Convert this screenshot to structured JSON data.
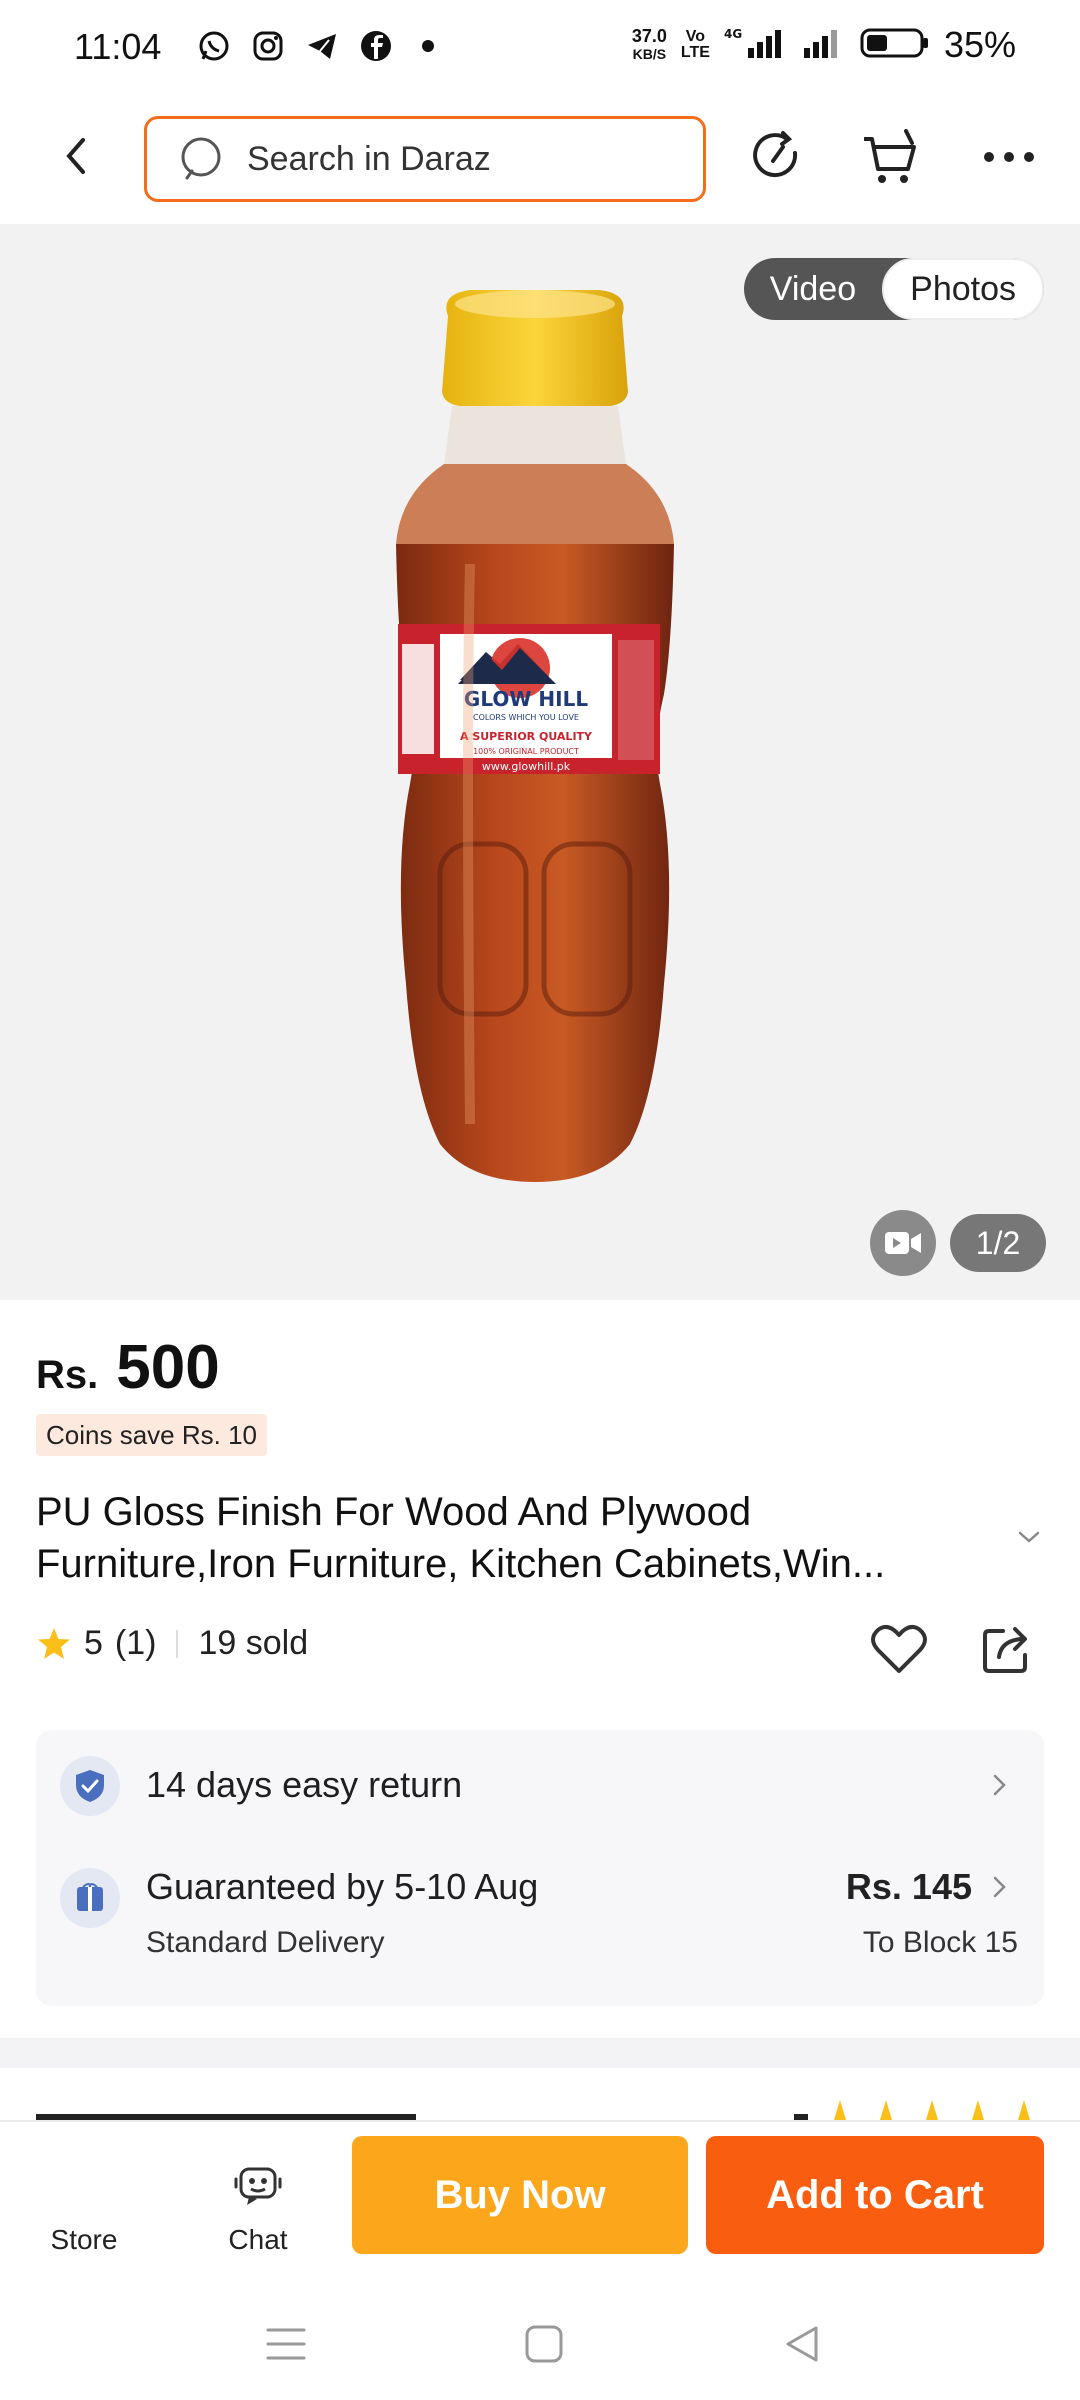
{
  "status_bar": {
    "time": "11:04",
    "app_icons": [
      "whatsapp-icon",
      "instagram-icon",
      "telegram-icon",
      "facebook-icon"
    ],
    "speed_value": "37.0",
    "speed_unit": "KB/S",
    "volte_top": "Vo",
    "volte_bottom": "LTE",
    "network": "4G",
    "battery": "35%"
  },
  "header": {
    "search_placeholder": "Search in Daraz",
    "accent_color": "#f36d1c"
  },
  "gallery": {
    "tabs": [
      "Video",
      "Photos"
    ],
    "active_tab": "Photos",
    "counter": "1/2",
    "label_brand": "GLOW HILL",
    "label_tagline": "COLORS WHICH YOU LOVE",
    "label_quality": "A SUPERIOR QUALITY",
    "label_original": "100% ORIGINAL PRODUCT",
    "label_site": "www.glowhill.pk"
  },
  "product": {
    "currency": "Rs.",
    "price": "500",
    "coins_text": "Coins save Rs. 10",
    "title_line1": "PU Gloss Finish For Wood And Plywood",
    "title_line2": "Furniture,Iron Furniture, Kitchen Cabinets,Win...",
    "rating": "5",
    "rating_count": "(1)",
    "sold": "19 sold"
  },
  "services": {
    "return_text": "14 days easy return",
    "delivery_text": "Guaranteed by 5-10 Aug",
    "delivery_type": "Standard Delivery",
    "delivery_fee": "Rs. 145",
    "delivery_dest": "To Block 15"
  },
  "action_bar": {
    "store_label": "Store",
    "chat_label": "Chat",
    "buy_now_label": "Buy Now",
    "add_to_cart_label": "Add to Cart",
    "buy_color": "#fba61b",
    "cart_color": "#f95e10"
  }
}
